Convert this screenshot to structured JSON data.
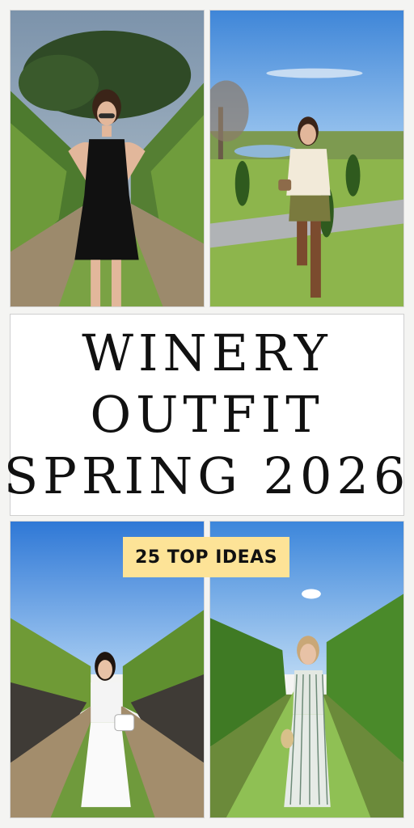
{
  "title": {
    "line1": "WINERY",
    "line2": "OUTFIT",
    "line3": "SPRING 2026"
  },
  "badge": {
    "text": "25 TOP IDEAS",
    "background": "#fde397"
  },
  "photos": [
    {
      "scene": "woman in black mini dress and sunglasses between vineyard rows"
    },
    {
      "scene": "woman in cream sweater, green skirt and brown boots holding wine glass on lawn with pond"
    },
    {
      "scene": "woman in white outfit holding wine glass and white bag in vineyard row"
    },
    {
      "scene": "woman in striped maxi dress holding wine glass in vineyard"
    }
  ]
}
